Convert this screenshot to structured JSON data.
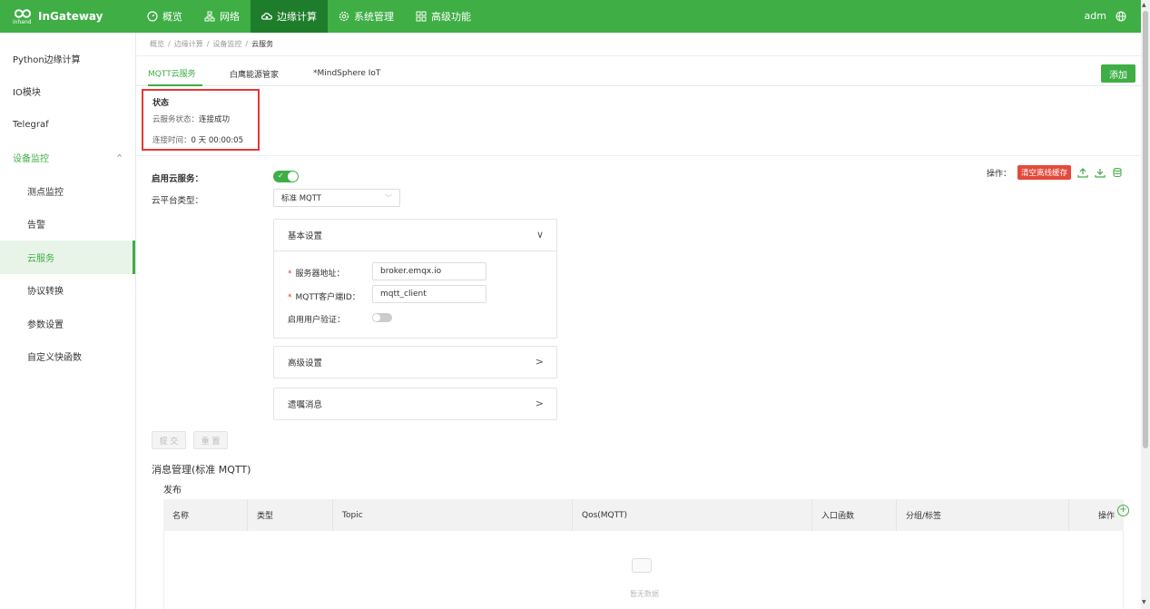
{
  "brand": {
    "logo_sub": "inhand",
    "name": "InGateway"
  },
  "topnav": [
    {
      "label": "概览",
      "icon": "dashboard-icon"
    },
    {
      "label": "网络",
      "icon": "network-icon"
    },
    {
      "label": "边缘计算",
      "icon": "edge-compute-icon",
      "active": true
    },
    {
      "label": "系统管理",
      "icon": "settings-icon"
    },
    {
      "label": "高级功能",
      "icon": "grid-icon"
    }
  ],
  "user": {
    "name": "adm"
  },
  "sidebar": {
    "items": [
      {
        "label": "Python边缘计算"
      },
      {
        "label": "IO模块"
      },
      {
        "label": "Telegraf"
      },
      {
        "label": "设备监控"
      },
      {
        "label": "测点监控"
      },
      {
        "label": "告警"
      },
      {
        "label": "云服务"
      },
      {
        "label": "协议转换"
      },
      {
        "label": "参数设置"
      },
      {
        "label": "自定义快函数"
      }
    ]
  },
  "breadcrumb": [
    "概览",
    "边缘计算",
    "设备监控",
    "云服务"
  ],
  "tabs": [
    "MQTT云服务",
    "白鹰能源管家",
    "*MindSphere IoT"
  ],
  "add_label": "添加",
  "status": {
    "title": "状态",
    "state_label": "云服务状态：",
    "state_value": "连接成功",
    "time_label": "连接时间：",
    "time_value": "0 天 00:00:05"
  },
  "form": {
    "enable_label": "启用云服务：",
    "enable_on": true,
    "platform_label": "云平台类型：",
    "platform_value": "标准 MQTT"
  },
  "ops": {
    "label": "操作：",
    "clear_cache": "清空离线缓存"
  },
  "basic": {
    "title": "基本设置",
    "server_label": "服务器地址：",
    "server_value": "broker.emqx.io",
    "client_label": "MQTT客户端ID：",
    "client_value": "mqtt_client",
    "auth_label": "启用用户验证：",
    "auth_on": false
  },
  "advanced": {
    "title": "高级设置"
  },
  "will": {
    "title": "遗嘱消息"
  },
  "buttons": {
    "submit": "提 交",
    "reset": "重 置"
  },
  "messages": {
    "title": "消息管理(标准 MQTT)",
    "publish": "发布",
    "columns": [
      "名称",
      "类型",
      "Topic",
      "Qos(MQTT)",
      "入口函数",
      "分组/标签",
      "操作"
    ],
    "empty": "暂无数据"
  }
}
